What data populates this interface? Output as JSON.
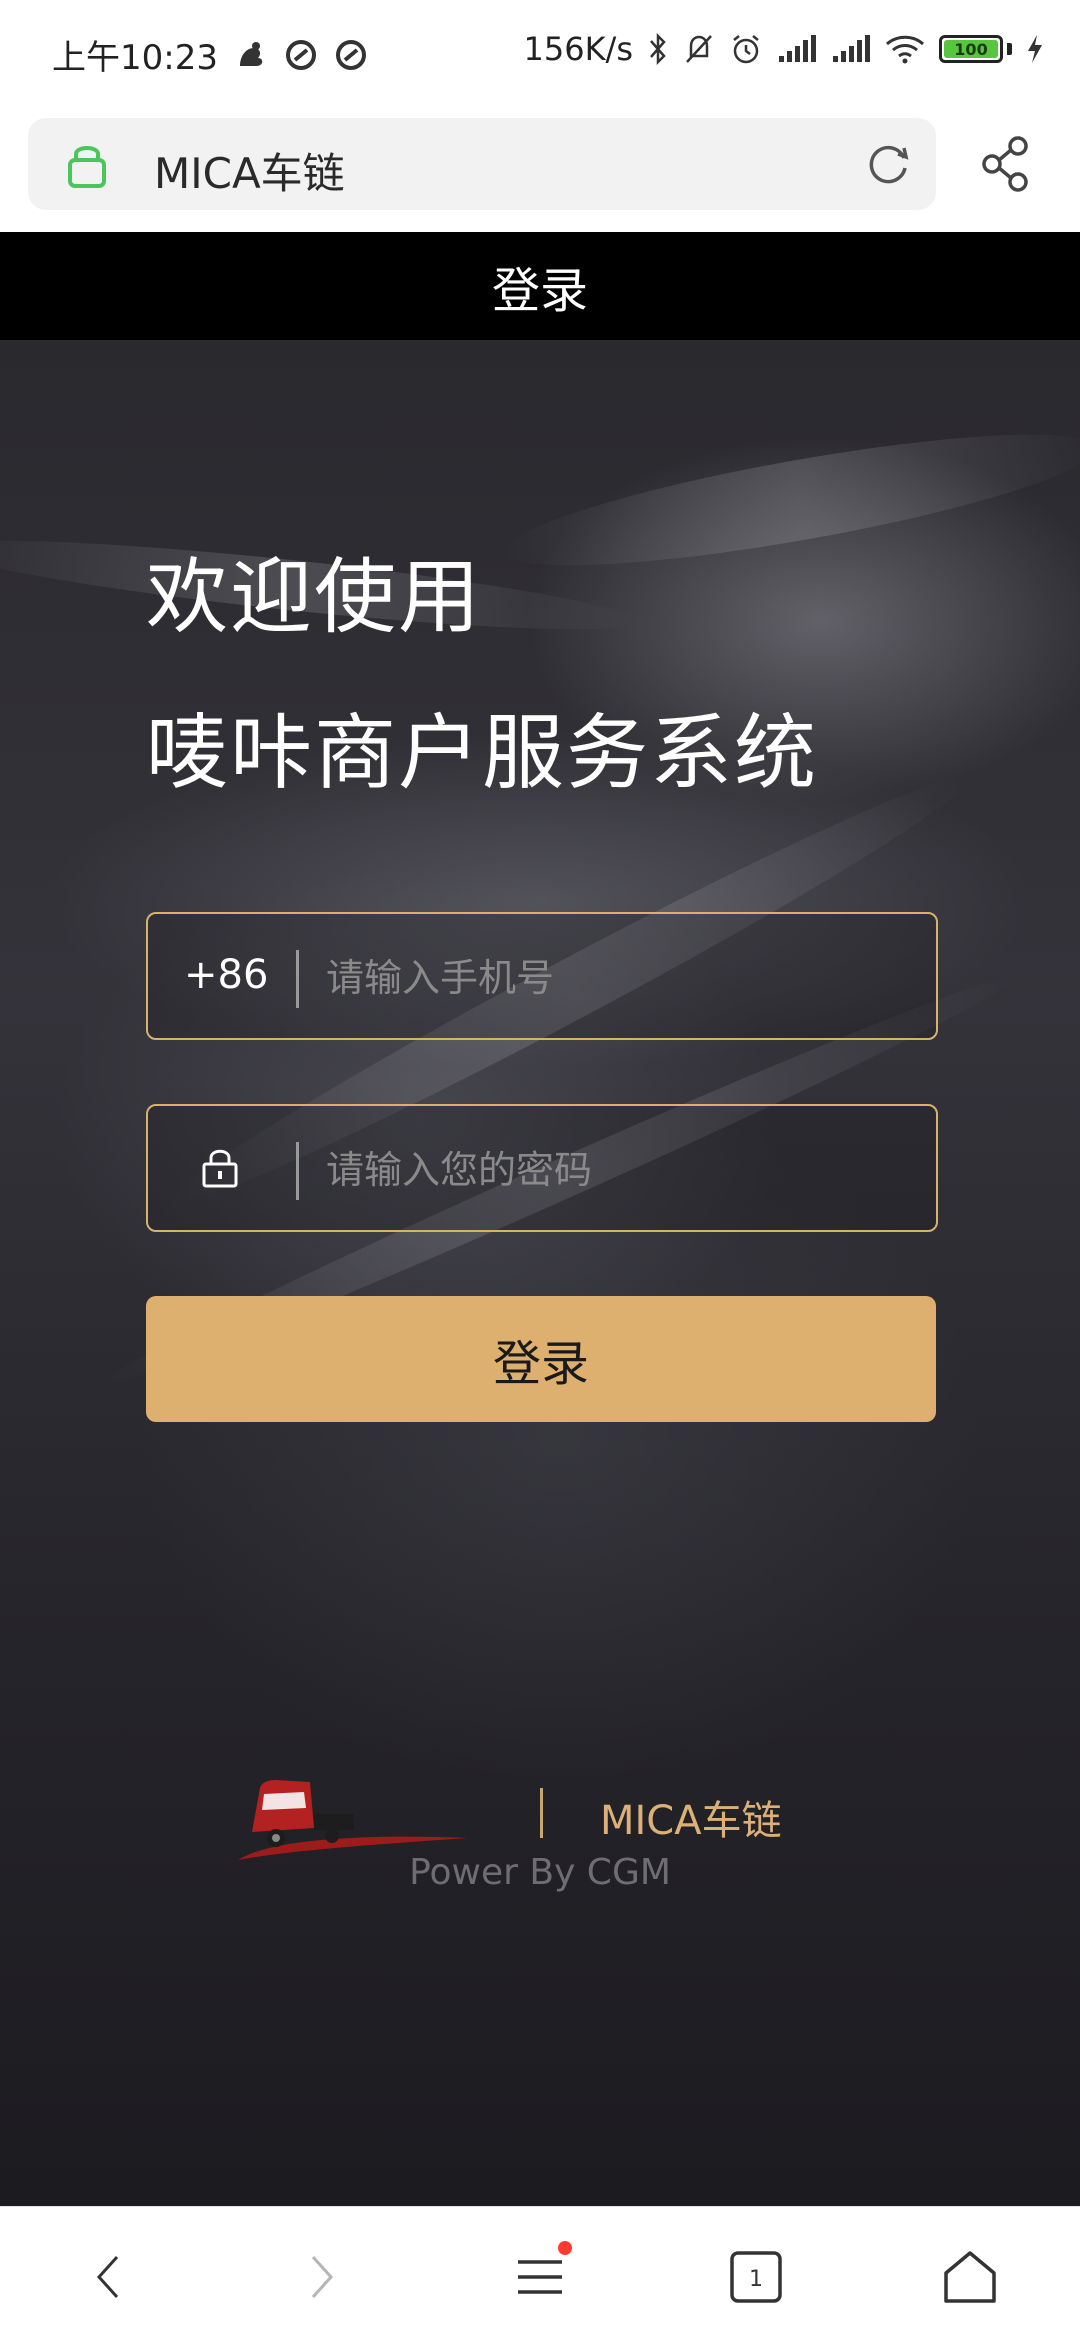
{
  "status_bar": {
    "time": "上午10:23",
    "network_speed": "156K/s",
    "battery": "100"
  },
  "browser": {
    "url_title": "MICA车链"
  },
  "page": {
    "title": "登录"
  },
  "hero": {
    "welcome_line1": "欢迎使用",
    "welcome_line2": "唛咔商户服务系统"
  },
  "form": {
    "phone_prefix": "+86",
    "phone_placeholder": "请输入手机号",
    "phone_value": "",
    "password_placeholder": "请输入您的密码",
    "password_value": "",
    "login_label": "登录"
  },
  "footer": {
    "logo_text": "MICA",
    "brand_name": "MICA车链",
    "powered_by": "Power By CGM"
  },
  "bottom_nav": {
    "tab_count": "1"
  },
  "colors": {
    "accent_gold": "#deb06f",
    "field_border": "#d8b16a",
    "secure_green": "#4cc55a",
    "badge_red": "#ff3b30"
  }
}
